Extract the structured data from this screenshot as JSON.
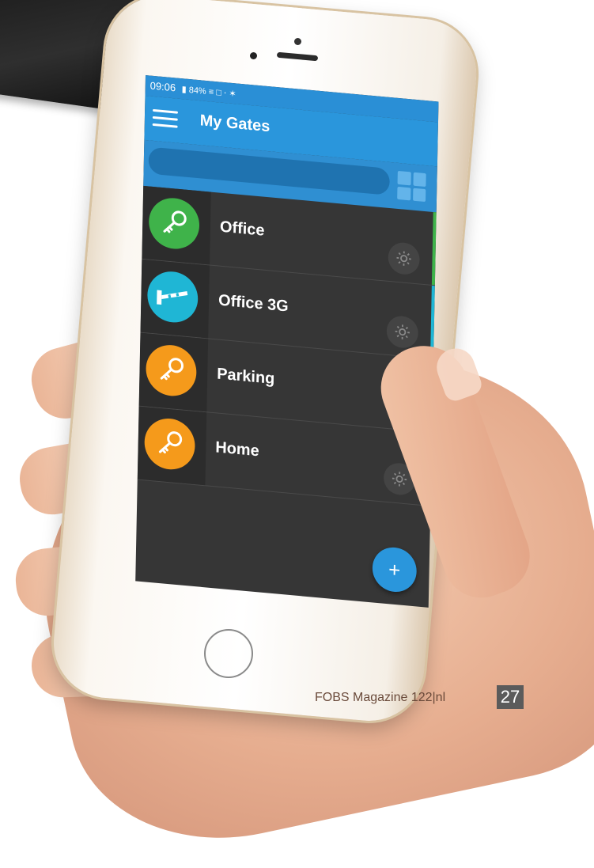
{
  "status_bar": {
    "time": "09:06",
    "battery": "84%",
    "icons": "▮ 84% ≡ □ ⋅ ✶"
  },
  "app_bar": {
    "title": "My Gates"
  },
  "search": {
    "value": "",
    "placeholder": ""
  },
  "gates": [
    {
      "name": "Office",
      "icon": "key-icon",
      "color": "#3fb34a",
      "accent": "#3fb34a"
    },
    {
      "name": "Office 3G",
      "icon": "barrier-icon",
      "color": "#1fb6d5",
      "accent": "#1fb6d5"
    },
    {
      "name": "Parking",
      "icon": "key-icon",
      "color": "#f59a1b",
      "accent": "#f59a1b"
    },
    {
      "name": "Home",
      "icon": "key-icon",
      "color": "#f59a1b",
      "accent": "#f59a1b"
    }
  ],
  "fab": {
    "label": "+"
  },
  "footer": {
    "text": "FOBS Magazine 122|nl",
    "page": "27"
  },
  "colors": {
    "primary": "#2a96dc",
    "list_bg": "#363636"
  }
}
